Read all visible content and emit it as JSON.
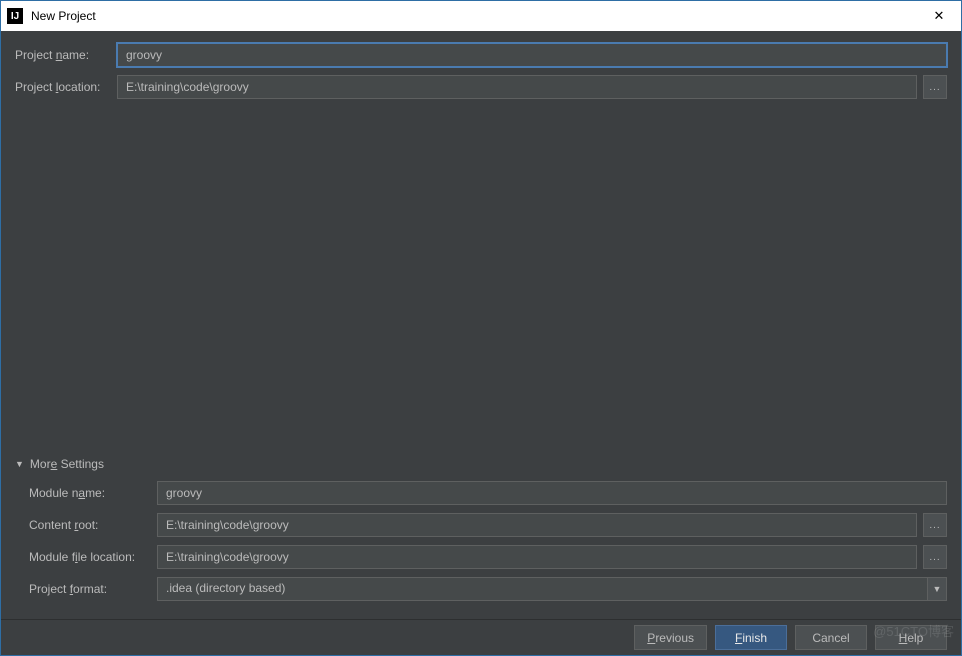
{
  "window": {
    "title": "New Project",
    "icon_label": "IJ"
  },
  "top_form": {
    "project_name_label": "Project name:",
    "project_name_value": "groovy",
    "project_location_label": "Project location:",
    "project_location_value": "E:\\training\\code\\groovy"
  },
  "more_settings": {
    "header": "More Settings",
    "module_name_label": "Module name:",
    "module_name_value": "groovy",
    "content_root_label": "Content root:",
    "content_root_value": "E:\\training\\code\\groovy",
    "module_file_location_label": "Module file location:",
    "module_file_location_value": "E:\\training\\code\\groovy",
    "project_format_label": "Project format:",
    "project_format_value": ".idea (directory based)"
  },
  "buttons": {
    "previous": "Previous",
    "finish": "Finish",
    "cancel": "Cancel",
    "help": "Help"
  },
  "watermark": "@51CTO博客",
  "browse_glyph": "..."
}
